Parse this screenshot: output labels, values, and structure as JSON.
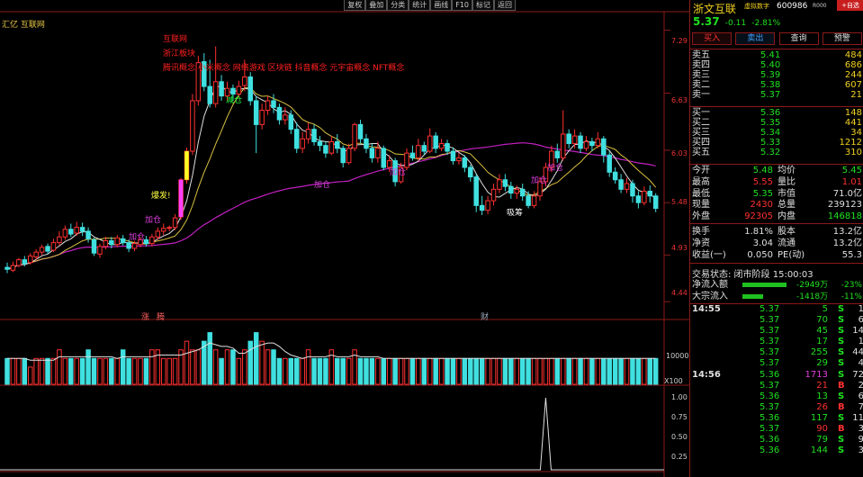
{
  "toolbar": [
    "复权",
    "叠加",
    "分类",
    "统计",
    "画线",
    "F10",
    "标记",
    "返回"
  ],
  "chart": {
    "title": "汇亿 互联网",
    "concepts": [
      "互联网",
      "浙江板块",
      "腾讯概念 小米概念 网络游戏 区块链 抖音概念 元宇宙概念 NFT概念"
    ],
    "price_axis": [
      "7.29",
      "6.63",
      "6.03",
      "5.48",
      "4.93",
      "4.44"
    ],
    "vol_axis": [
      "10000",
      "X100"
    ],
    "ind_axis": [
      "1.00",
      "0.75",
      "0.50",
      "0.25"
    ],
    "annotations": [
      {
        "text": "减仓",
        "cls": "green",
        "x": 251,
        "y": 104
      },
      {
        "text": "爆发!",
        "cls": "yellow",
        "x": 168,
        "y": 210
      },
      {
        "text": "加仓",
        "cls": "magenta",
        "x": 161,
        "y": 237
      },
      {
        "text": "加仓",
        "cls": "magenta",
        "x": 143,
        "y": 256
      },
      {
        "text": "加仓",
        "cls": "magenta",
        "x": 349,
        "y": 198
      },
      {
        "text": "加仓",
        "cls": "magenta",
        "x": 433,
        "y": 184
      },
      {
        "text": "加仓",
        "cls": "magenta",
        "x": 590,
        "y": 193
      },
      {
        "text": "加仓",
        "cls": "magenta",
        "x": 608,
        "y": 179
      },
      {
        "text": "吸筹",
        "cls": "white",
        "x": 563,
        "y": 229
      }
    ],
    "events": [
      {
        "text": "涨",
        "x": 157,
        "blue": false
      },
      {
        "text": "腾",
        "x": 174,
        "blue": false
      },
      {
        "text": "财",
        "x": 534,
        "blue": true
      }
    ]
  },
  "chart_data": {
    "type": "candlestick",
    "ylim": [
      4.3,
      7.4
    ],
    "candles": [
      [
        4.8,
        4.78,
        4.85,
        4.74
      ],
      [
        4.77,
        4.82,
        4.86,
        4.75
      ],
      [
        4.82,
        4.88,
        4.9,
        4.8
      ],
      [
        4.88,
        4.84,
        4.92,
        4.81
      ],
      [
        4.85,
        4.92,
        4.95,
        4.83
      ],
      [
        4.91,
        4.96,
        4.99,
        4.88
      ],
      [
        4.96,
        5.01,
        5.04,
        4.93
      ],
      [
        5.02,
        4.97,
        5.05,
        4.94
      ],
      [
        4.98,
        5.06,
        5.1,
        4.96
      ],
      [
        5.06,
        5.12,
        5.18,
        5.03
      ],
      [
        5.12,
        5.2,
        5.24,
        5.09
      ],
      [
        5.2,
        5.15,
        5.26,
        5.12
      ],
      [
        5.16,
        5.22,
        5.28,
        5.13
      ],
      [
        5.22,
        5.18,
        5.27,
        5.13
      ],
      [
        5.18,
        5.1,
        5.22,
        5.06
      ],
      [
        5.09,
        4.95,
        5.11,
        4.92
      ],
      [
        4.94,
        5.02,
        5.05,
        4.9
      ],
      [
        5.02,
        5.08,
        5.12,
        4.99
      ],
      [
        5.08,
        5.04,
        5.12,
        5.0
      ],
      [
        5.04,
        5.11,
        5.14,
        5.01
      ],
      [
        5.1,
        5.06,
        5.14,
        5.03
      ],
      [
        5.06,
        5.0,
        5.09,
        4.96
      ],
      [
        5.0,
        5.05,
        5.08,
        4.97
      ],
      [
        5.04,
        5.09,
        5.12,
        5.01
      ],
      [
        5.09,
        5.05,
        5.13,
        5.02
      ],
      [
        5.05,
        5.12,
        5.15,
        5.02
      ],
      [
        5.12,
        5.18,
        5.22,
        5.09
      ],
      [
        5.18,
        5.21,
        5.26,
        5.14
      ],
      [
        5.21,
        5.22,
        5.24,
        5.18
      ],
      [
        5.22,
        5.32,
        5.36,
        5.19
      ],
      [
        5.33,
        5.72,
        5.74,
        5.3
      ],
      [
        5.72,
        6.02,
        6.06,
        5.68
      ],
      [
        6.02,
        6.55,
        6.62,
        5.98
      ],
      [
        6.55,
        6.95,
        7.02,
        6.5
      ],
      [
        6.96,
        6.7,
        7.05,
        6.65
      ],
      [
        6.7,
        6.52,
        6.98,
        6.48
      ],
      [
        6.52,
        6.75,
        7.12,
        6.48
      ],
      [
        6.75,
        6.6,
        6.82,
        6.55
      ],
      [
        6.6,
        6.68,
        6.75,
        6.55
      ],
      [
        6.68,
        6.62,
        6.72,
        6.55
      ],
      [
        6.62,
        6.7,
        6.76,
        6.58
      ],
      [
        6.71,
        6.8,
        6.98,
        6.65
      ],
      [
        6.8,
        6.55,
        6.85,
        6.5
      ],
      [
        6.55,
        6.3,
        6.6,
        6.0
      ],
      [
        6.3,
        6.45,
        6.52,
        6.25
      ],
      [
        6.45,
        6.55,
        6.6,
        6.4
      ],
      [
        6.55,
        6.48,
        6.62,
        6.42
      ],
      [
        6.48,
        6.35,
        6.52,
        6.3
      ],
      [
        6.35,
        6.4,
        6.48,
        6.3
      ],
      [
        6.4,
        6.25,
        6.45,
        6.2
      ],
      [
        6.25,
        6.05,
        6.32,
        6.0
      ],
      [
        6.05,
        6.15,
        6.22,
        6.0
      ],
      [
        6.15,
        6.25,
        6.32,
        6.1
      ],
      [
        6.25,
        6.12,
        6.3,
        6.08
      ],
      [
        6.12,
        6.08,
        6.18,
        6.02
      ],
      [
        6.08,
        6.0,
        6.12,
        5.95
      ],
      [
        6.0,
        6.12,
        6.18,
        5.98
      ],
      [
        6.12,
        6.05,
        6.2,
        6.0
      ],
      [
        6.05,
        5.9,
        6.08,
        5.85
      ],
      [
        5.9,
        6.05,
        6.1,
        5.88
      ],
      [
        6.05,
        6.3,
        6.32,
        6.02
      ],
      [
        6.3,
        6.15,
        6.35,
        6.1
      ],
      [
        6.15,
        6.05,
        6.2,
        6.0
      ],
      [
        6.05,
        5.95,
        6.1,
        5.9
      ],
      [
        5.95,
        6.05,
        6.12,
        5.9
      ],
      [
        6.05,
        5.85,
        6.08,
        5.82
      ],
      [
        5.85,
        5.92,
        5.98,
        5.8
      ],
      [
        5.92,
        5.7,
        5.95,
        5.65
      ],
      [
        5.7,
        5.85,
        5.9,
        5.68
      ],
      [
        5.85,
        6.0,
        6.05,
        5.82
      ],
      [
        6.0,
        5.95,
        6.08,
        5.92
      ],
      [
        5.95,
        6.08,
        6.15,
        5.92
      ],
      [
        6.08,
        6.02,
        6.12,
        5.98
      ],
      [
        6.02,
        6.18,
        6.26,
        6.0
      ],
      [
        6.18,
        6.05,
        6.22,
        6.0
      ],
      [
        6.05,
        6.1,
        6.15,
        6.02
      ],
      [
        6.1,
        6.02,
        6.14,
        5.98
      ],
      [
        6.02,
        5.92,
        6.06,
        5.88
      ],
      [
        5.92,
        5.95,
        6.0,
        5.88
      ],
      [
        5.95,
        5.85,
        5.98,
        5.8
      ],
      [
        5.85,
        5.75,
        5.88,
        5.7
      ],
      [
        5.75,
        5.45,
        5.78,
        5.38
      ],
      [
        5.45,
        5.4,
        5.55,
        5.35
      ],
      [
        5.4,
        5.5,
        5.55,
        5.36
      ],
      [
        5.5,
        5.62,
        5.68,
        5.45
      ],
      [
        5.62,
        5.72,
        5.78,
        5.58
      ],
      [
        5.72,
        5.65,
        5.78,
        5.6
      ],
      [
        5.65,
        5.58,
        5.7,
        5.52
      ],
      [
        5.58,
        5.62,
        5.66,
        5.52
      ],
      [
        5.62,
        5.55,
        5.68,
        5.5
      ],
      [
        5.55,
        5.45,
        5.6,
        5.42
      ],
      [
        5.45,
        5.55,
        5.6,
        5.42
      ],
      [
        5.55,
        5.7,
        5.75,
        5.5
      ],
      [
        5.7,
        5.85,
        5.9,
        5.65
      ],
      [
        5.85,
        6.02,
        6.08,
        5.8
      ],
      [
        6.02,
        5.95,
        6.1,
        5.9
      ],
      [
        5.95,
        6.2,
        6.45,
        5.92
      ],
      [
        6.2,
        6.1,
        6.25,
        6.05
      ],
      [
        6.1,
        6.18,
        6.25,
        6.05
      ],
      [
        6.18,
        6.05,
        6.22,
        6.0
      ],
      [
        6.05,
        6.12,
        6.18,
        6.02
      ],
      [
        6.12,
        6.08,
        6.16,
        6.02
      ],
      [
        6.08,
        6.15,
        6.22,
        6.05
      ],
      [
        6.15,
        5.98,
        6.18,
        5.9
      ],
      [
        5.98,
        5.8,
        6.02,
        5.75
      ],
      [
        5.8,
        5.72,
        5.85,
        5.68
      ],
      [
        5.72,
        5.62,
        5.78,
        5.58
      ],
      [
        5.62,
        5.68,
        5.74,
        5.58
      ],
      [
        5.68,
        5.55,
        5.72,
        5.48
      ],
      [
        5.55,
        5.48,
        5.6,
        5.42
      ],
      [
        5.48,
        5.6,
        5.65,
        5.45
      ],
      [
        5.6,
        5.55,
        5.66,
        5.48
      ],
      [
        5.55,
        5.42,
        5.58,
        5.38
      ]
    ],
    "volumes": [
      3,
      3,
      3,
      3,
      2,
      3,
      3,
      3,
      3,
      4,
      3,
      3,
      3,
      3,
      4,
      3,
      3,
      3,
      3,
      3,
      4,
      3,
      3,
      3,
      3,
      4,
      4,
      3,
      3,
      3,
      4,
      5,
      4,
      4,
      5,
      6,
      4,
      3,
      4,
      4,
      3,
      4,
      5,
      6,
      5,
      4,
      4,
      3,
      3,
      3,
      3,
      3,
      4,
      3,
      3,
      3,
      4,
      3,
      3,
      3,
      4,
      3,
      3,
      3,
      3,
      3,
      3,
      3,
      3,
      3,
      3,
      3,
      3,
      3,
      3,
      3,
      3,
      3,
      3,
      3,
      3,
      3,
      3,
      3,
      3,
      3,
      3,
      3,
      3,
      3,
      3,
      3,
      3,
      3,
      3,
      3,
      3,
      3,
      3,
      3,
      3,
      3,
      3,
      3,
      3,
      3,
      3,
      3,
      3,
      3,
      3,
      3,
      3
    ],
    "indicator_spike_index": 93
  },
  "panel": {
    "name": "浙文互联",
    "tag": "虚拟数字",
    "code": "600986",
    "code2": "R000",
    "add_label": "+自选",
    "price": "5.37",
    "change": "-0.11",
    "change_pct": "-2.81%",
    "buttons": [
      "买入",
      "卖出",
      "查询",
      "预警"
    ],
    "asks": [
      {
        "lbl": "卖五",
        "pr": "5.41",
        "vol": "484"
      },
      {
        "lbl": "卖四",
        "pr": "5.40",
        "vol": "686"
      },
      {
        "lbl": "卖三",
        "pr": "5.39",
        "vol": "244"
      },
      {
        "lbl": "卖二",
        "pr": "5.38",
        "vol": "607"
      },
      {
        "lbl": "卖一",
        "pr": "5.37",
        "vol": "21"
      }
    ],
    "bids": [
      {
        "lbl": "买一",
        "pr": "5.36",
        "vol": "148"
      },
      {
        "lbl": "买二",
        "pr": "5.35",
        "vol": "441"
      },
      {
        "lbl": "买三",
        "pr": "5.34",
        "vol": "34"
      },
      {
        "lbl": "买四",
        "pr": "5.33",
        "vol": "1212"
      },
      {
        "lbl": "买五",
        "pr": "5.32",
        "vol": "310"
      }
    ],
    "stats1": [
      {
        "l1": "今开",
        "v1": "5.48",
        "c1": "c-green",
        "l2": "均价",
        "v2": "5.45",
        "c2": "c-green"
      },
      {
        "l1": "最高",
        "v1": "5.55",
        "c1": "c-red",
        "l2": "量比",
        "v2": "1.01",
        "c2": "c-red"
      },
      {
        "l1": "最低",
        "v1": "5.35",
        "c1": "c-green",
        "l2": "市值",
        "v2": "71.0亿",
        "c2": "c-white"
      },
      {
        "l1": "现量",
        "v1": "2430",
        "c1": "c-red",
        "l2": "总量",
        "v2": "239123",
        "c2": "c-white"
      },
      {
        "l1": "外盘",
        "v1": "92305",
        "c1": "c-red",
        "l2": "内盘",
        "v2": "146818",
        "c2": "c-green"
      }
    ],
    "stats2": [
      {
        "l1": "换手",
        "v1": "1.81%",
        "c1": "c-white",
        "l2": "股本",
        "v2": "13.2亿",
        "c2": "c-white"
      },
      {
        "l1": "净资",
        "v1": "3.04",
        "c1": "c-white",
        "l2": "流通",
        "v2": "13.2亿",
        "c2": "c-white"
      },
      {
        "l1": "收益(一)",
        "v1": "0.050",
        "c1": "c-white",
        "l2": "PE(动)",
        "v2": "55.3",
        "c2": "c-white"
      }
    ],
    "status": "交易状态: 闭市阶段 15:00:03",
    "flows": [
      {
        "lbl": "净流入额",
        "val": "-2949万",
        "pct": "-23%",
        "bar": 0.85
      },
      {
        "lbl": "大宗流入",
        "val": "-1418万",
        "pct": "-11%",
        "bar": 0.4
      }
    ],
    "ticks": [
      {
        "t": "14:55",
        "p": "5.37",
        "v": "5",
        "s": "S",
        "n": "1"
      },
      {
        "t": "",
        "p": "5.37",
        "v": "70",
        "s": "S",
        "n": "6"
      },
      {
        "t": "",
        "p": "5.37",
        "v": "45",
        "s": "S",
        "n": "14"
      },
      {
        "t": "",
        "p": "5.37",
        "v": "17",
        "s": "S",
        "n": "1"
      },
      {
        "t": "",
        "p": "5.37",
        "v": "255",
        "s": "S",
        "n": "44"
      },
      {
        "t": "",
        "p": "5.37",
        "v": "29",
        "s": "S",
        "n": "4"
      },
      {
        "t": "14:56",
        "p": "5.36",
        "v": "1713",
        "s": "S",
        "n": "72"
      },
      {
        "t": "",
        "p": "5.37",
        "v": "21",
        "s": "B",
        "n": "2"
      },
      {
        "t": "",
        "p": "5.36",
        "v": "13",
        "s": "S",
        "n": "6"
      },
      {
        "t": "",
        "p": "5.37",
        "v": "26",
        "s": "B",
        "n": "7"
      },
      {
        "t": "",
        "p": "5.36",
        "v": "117",
        "s": "S",
        "n": "11"
      },
      {
        "t": "",
        "p": "5.37",
        "v": "90",
        "s": "B",
        "n": "3"
      },
      {
        "t": "",
        "p": "5.36",
        "v": "79",
        "s": "S",
        "n": "9"
      },
      {
        "t": "",
        "p": "5.36",
        "v": "144",
        "s": "S",
        "n": "3"
      }
    ]
  }
}
